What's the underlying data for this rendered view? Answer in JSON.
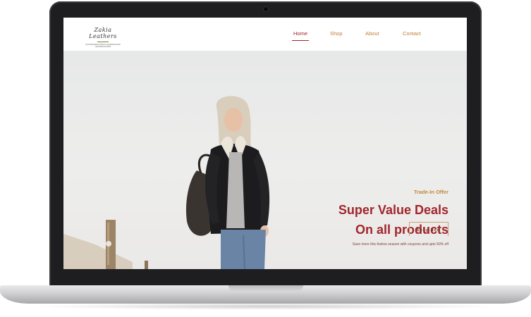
{
  "site": {
    "logo_script": "Zakia Leathers",
    "logo_tagline": "SUSTAINABLE ETHICAL HANDCRAFTED LEATHER GOODS"
  },
  "nav": {
    "items": [
      {
        "label": "Home",
        "active": true
      },
      {
        "label": "Shop",
        "active": false
      },
      {
        "label": "About",
        "active": false
      },
      {
        "label": "Contact",
        "active": false
      }
    ]
  },
  "hero": {
    "eyebrow": "Trade-In Offer",
    "headline_line1": "Super Value Deals",
    "headline_line2": "On all products",
    "subtext": "Save more this festive season with coupons and upto 50% off",
    "cta_label": "Shop Now"
  },
  "colors": {
    "accent_red": "#a3262c",
    "accent_gold": "#c18a3f",
    "laptop_frame": "#1e1e20"
  }
}
